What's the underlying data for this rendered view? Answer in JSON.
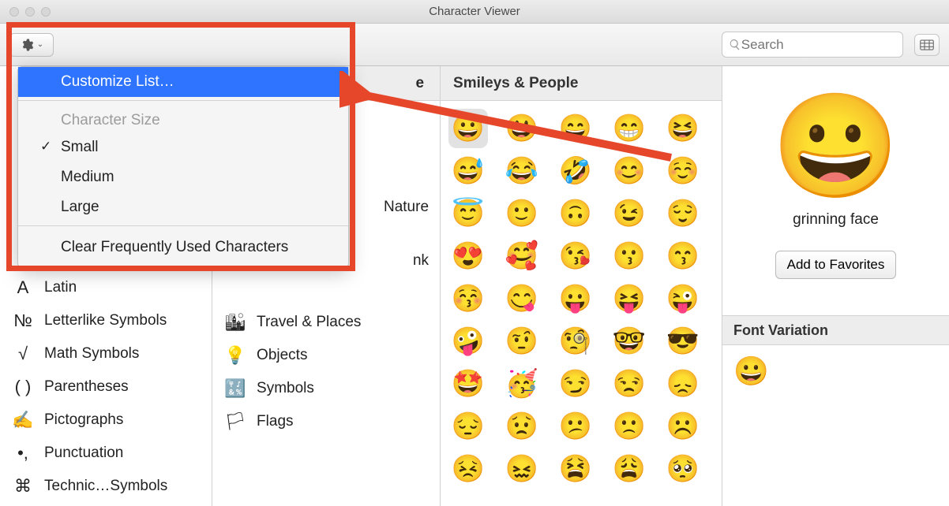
{
  "window": {
    "title": "Character Viewer"
  },
  "toolbar": {
    "search_placeholder": "Search"
  },
  "dropdown": {
    "customize": "Customize List…",
    "size_label": "Character Size",
    "small": "Small",
    "medium": "Medium",
    "large": "Large",
    "clear": "Clear Frequently Used Characters"
  },
  "sidebar": {
    "items": [
      {
        "label": "Latin"
      },
      {
        "label": "Letterlike Symbols"
      },
      {
        "label": "Math Symbols"
      },
      {
        "label": "Parentheses"
      },
      {
        "label": "Pictographs"
      },
      {
        "label": "Punctuation"
      },
      {
        "label": "Technic…Symbols"
      }
    ]
  },
  "col2": {
    "header_partial": "e",
    "frag1": "Nature",
    "frag2": "nk",
    "items": [
      {
        "label": "Travel & Places"
      },
      {
        "label": "Objects"
      },
      {
        "label": "Symbols"
      },
      {
        "label": "Flags"
      }
    ]
  },
  "grid": {
    "header": "Smileys & People",
    "emojis": [
      "😀",
      "😃",
      "😄",
      "😁",
      "😆",
      "😅",
      "😂",
      "🤣",
      "😊",
      "☺️",
      "😇",
      "🙂",
      "🙃",
      "😉",
      "😌",
      "😍",
      "🥰",
      "😘",
      "😗",
      "😙",
      "😚",
      "😋",
      "😛",
      "😝",
      "😜",
      "🤪",
      "🤨",
      "🧐",
      "🤓",
      "😎",
      "🤩",
      "🥳",
      "😏",
      "😒",
      "😞",
      "😔",
      "😟",
      "😕",
      "🙁",
      "☹️",
      "😣",
      "😖",
      "😫",
      "😩",
      "🥺"
    ]
  },
  "preview": {
    "emoji": "😀",
    "name": "grinning face",
    "fav_label": "Add to Favorites",
    "variation_header": "Font Variation",
    "variation_emoji": "😀"
  }
}
